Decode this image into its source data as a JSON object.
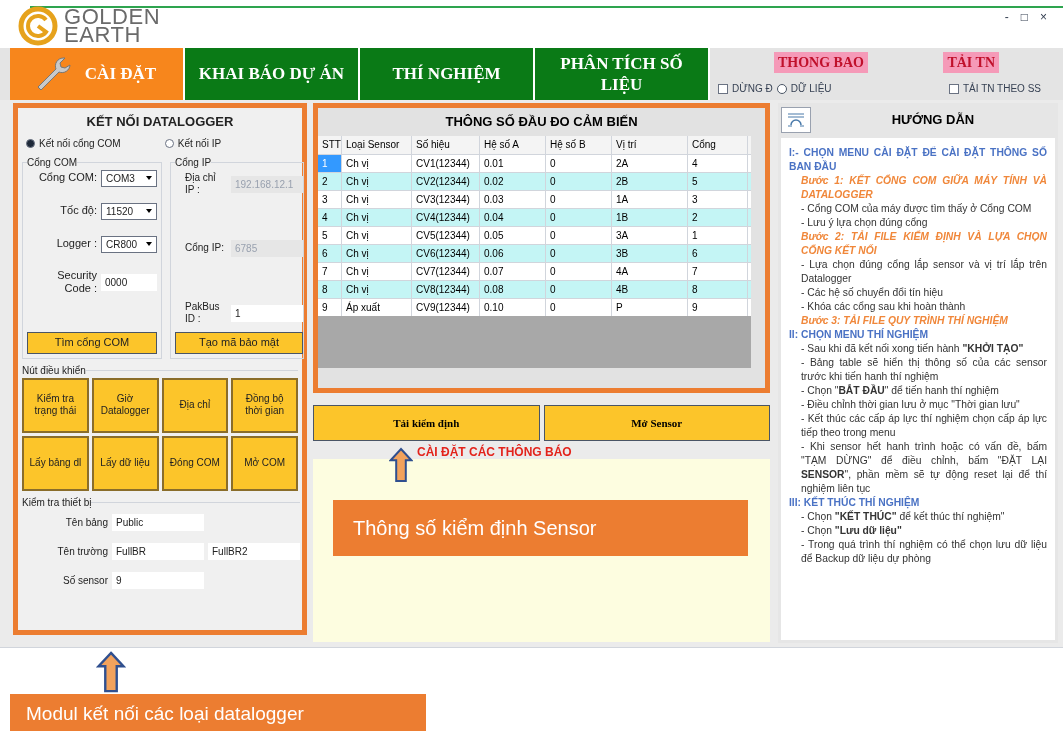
{
  "window": {
    "logo_top": "GOLDEN",
    "logo_bottom": "EARTH",
    "controls": [
      "-",
      "□",
      "×"
    ]
  },
  "tabs": [
    {
      "label": "CÀI ĐẶT",
      "selected": true
    },
    {
      "label": "KHAI BÁO DỰ ÁN",
      "selected": false
    },
    {
      "label": "THÍ NGHIỆM",
      "selected": false
    },
    {
      "label": "PHÂN TÍCH SỐ LIỆU",
      "selected": false
    }
  ],
  "toolbar": {
    "notice": "THONG BAO",
    "reload": "TẢI TN",
    "checkboxes": [
      {
        "label": "DỪNG Đ",
        "label_rest": "DỮ LIỆU",
        "checked": false
      },
      {
        "label": "TẢI TN THEO SS",
        "checked": false
      }
    ]
  },
  "connection_panel": {
    "title": "KẾT NỐI DATALOGGER",
    "modes": [
      {
        "label": "Kết nối cổng COM",
        "selected": true
      },
      {
        "label": "Kết nối IP",
        "selected": false
      }
    ],
    "com_group": {
      "title": "Cổng COM",
      "fields": [
        {
          "label": "Cổng COM:",
          "kind": "select",
          "value": "COM3"
        },
        {
          "label": "Tốc độ:",
          "kind": "select",
          "value": "11520"
        },
        {
          "label": "Logger :",
          "kind": "select",
          "value": "CR800"
        },
        {
          "label": "Security Code :",
          "kind": "input",
          "value": "0000"
        }
      ],
      "button": "Tìm cổng COM"
    },
    "ip_group": {
      "title": "Cổng IP",
      "fields": [
        {
          "label": "Địa chỉ IP :",
          "value": "192.168.12.1",
          "disabled": true
        },
        {
          "label": "Cổng IP:",
          "value": "6785",
          "disabled": true
        },
        {
          "label": "PakBus ID :",
          "value": "1",
          "disabled": false
        }
      ],
      "button": "Tạo mã bảo mật"
    },
    "controls_group": {
      "title": "Nút điều khiển",
      "buttons": [
        "Kiểm tra trạng thái",
        "Giờ Datalogger",
        "Địa chỉ",
        "Đồng bộ thời gian",
        "Lấy bảng dl",
        "Lấy dữ liệu",
        "Đóng COM",
        "Mở COM"
      ]
    },
    "device_group": {
      "title": "Kiểm tra thiết bị",
      "fields": [
        {
          "label": "Tên bảng",
          "values": [
            "Public"
          ]
        },
        {
          "label": "Tên trường",
          "values": [
            "FullBR",
            "FullBR2"
          ]
        },
        {
          "label": "Số sensor",
          "values": [
            "9"
          ]
        }
      ]
    }
  },
  "sensor_table": {
    "title": "THÔNG SỐ ĐẦU ĐO CẢM BIẾN",
    "columns": [
      "STT",
      "Loại Sensor",
      "Số hiệu",
      "Hệ số A",
      "Hệ số B",
      "Vị trí",
      "Cổng"
    ],
    "rows": [
      {
        "cells": [
          "1",
          "Ch vị",
          "CV1(12344)",
          "0.01",
          "0",
          "2A",
          "4"
        ],
        "selected": true
      },
      {
        "cells": [
          "2",
          "Ch vị",
          "CV2(12344)",
          "0.02",
          "0",
          "2B",
          "5"
        ],
        "selected": false
      },
      {
        "cells": [
          "3",
          "Ch vị",
          "CV3(12344)",
          "0.03",
          "0",
          "1A",
          "3"
        ],
        "selected": false
      },
      {
        "cells": [
          "4",
          "Ch vị",
          "CV4(12344)",
          "0.04",
          "0",
          "1B",
          "2"
        ],
        "selected": false
      },
      {
        "cells": [
          "5",
          "Ch vị",
          "CV5(12344)",
          "0.05",
          "0",
          "3A",
          "1"
        ],
        "selected": false
      },
      {
        "cells": [
          "6",
          "Ch vị",
          "CV6(12344)",
          "0.06",
          "0",
          "3B",
          "6"
        ],
        "selected": false
      },
      {
        "cells": [
          "7",
          "Ch vị",
          "CV7(12344)",
          "0.07",
          "0",
          "4A",
          "7"
        ],
        "selected": false
      },
      {
        "cells": [
          "8",
          "Ch vị",
          "CV8(12344)",
          "0.08",
          "0",
          "4B",
          "8"
        ],
        "selected": false
      },
      {
        "cells": [
          "9",
          "Áp xuất",
          "CV9(12344)",
          "0.10",
          "0",
          "P",
          "9"
        ],
        "selected": false
      }
    ]
  },
  "sensor_buttons": [
    "Tải kiểm định",
    "Mở Sensor"
  ],
  "annotations": {
    "notice_caption": "CÀI ĐẶT CÁC THÔNG BÁO",
    "sensor_callout": "Thông số kiểm định Sensor",
    "module_callout": "Modul kết nối các loại datalogger"
  },
  "guide": {
    "title": "HƯỚNG DẪN",
    "lines": [
      {
        "kind": "heading",
        "text": "I:- CHỌN MENU CÀI ĐẶT ĐỂ CÀI ĐẶT THÔNG SỐ BAN ĐẦU"
      },
      {
        "kind": "step",
        "text": "Bước 1: KẾT CỔNG COM GIỮA MÁY TÍNH VÀ DATALOGGER"
      },
      {
        "kind": "item",
        "text": "- Cổng COM của máy được tìm thấy ở Cổng COM"
      },
      {
        "kind": "item",
        "text": "- Lưu ý lựa chọn đúng cổng"
      },
      {
        "kind": "step",
        "text": "Bước 2: TẢI FILE KIỂM ĐỊNH VÀ LỰA CHỌN CỔNG KẾT NỐI"
      },
      {
        "kind": "item",
        "text": "- Lựa chọn đúng cổng lắp sensor và vị trí lắp trên Datalogger"
      },
      {
        "kind": "item",
        "text": "- Các hệ số chuyển đổi tín hiệu"
      },
      {
        "kind": "item",
        "text": "- Khóa các cổng sau khi hoàn thành"
      },
      {
        "kind": "step",
        "text": "Bước 3: TẢI FILE QUY TRÌNH THÍ NGHIỆM"
      },
      {
        "kind": "heading",
        "text": "II: CHỌN MENU THÍ NGHIỆM"
      },
      {
        "kind": "item",
        "text": "- Sau khi đã kết nối xong tiến hành **\"KHỞI TẠO\"**"
      },
      {
        "kind": "item",
        "text": "- Bảng table sẽ hiển thị thông số của các sensor trước khi tiến hanh thí nghiệm"
      },
      {
        "kind": "item",
        "text": "- Chọn \"**BẮT ĐẦU**\" để tiến hanh thí nghiệm"
      },
      {
        "kind": "item",
        "text": "- Điều chỉnh thời gian lưu ở mục \"Thời gian lưu\""
      },
      {
        "kind": "item",
        "text": "- Kết thúc các cấp áp lực thí nghiệm chọn cấp áp lực tiếp theo trong menu"
      },
      {
        "kind": "item",
        "text": "- Khi sensor hết hanh trình hoặc có vấn đề, bấm \"TẠM DỪNG\" để điều chỉnh, bấm \"ĐẶT LẠI **SENSOR**\", phần mềm sẽ tự động reset lại để thí nghiệm liên tục"
      },
      {
        "kind": "heading",
        "text": "III: KẾT THÚC THÍ NGHIỆM"
      },
      {
        "kind": "item",
        "text": "- Chọn **\"KẾT THÚC\"** để kết thúc thí nghiệm\""
      },
      {
        "kind": "item",
        "text": "- Chọn **\"Lưu dữ liệu\"**"
      },
      {
        "kind": "item",
        "text": "- Trong quá trình thí nghiệm có thể chọn lưu dữ liệu để Backup dữ liệu dự phòng"
      }
    ]
  }
}
